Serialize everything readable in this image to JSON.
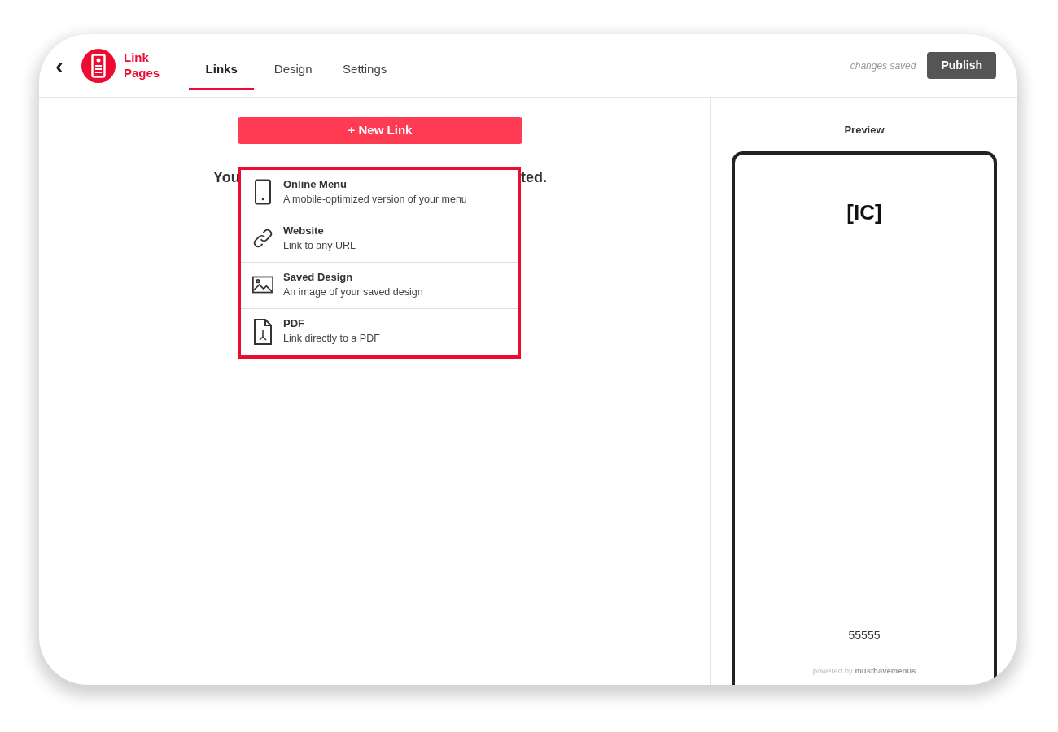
{
  "header": {
    "back": "‹",
    "brand": [
      "Link",
      "Pages"
    ],
    "tabs": [
      {
        "label": "Links",
        "selected": true
      },
      {
        "label": "Design",
        "selected": false
      },
      {
        "label": "Settings",
        "selected": false
      }
    ],
    "status": "changes saved",
    "publish": "Publish"
  },
  "editor": {
    "new_link": "+ New Link",
    "message_fragments": [
      "You",
      "ted."
    ],
    "menu": [
      {
        "kind": "phone",
        "title": "Online Menu",
        "description": "A mobile-optimized version of your menu"
      },
      {
        "kind": "link",
        "title": "Website",
        "description": "Link to any URL"
      },
      {
        "kind": "image",
        "title": "Saved Design",
        "description": "An image of your saved design"
      },
      {
        "kind": "pdf",
        "title": "PDF",
        "description": "Link directly to a PDF"
      }
    ]
  },
  "preview": {
    "title": "Preview",
    "name": "[IC]",
    "phone_number": "55555",
    "footer": "powered by **musthavemenus**"
  }
}
